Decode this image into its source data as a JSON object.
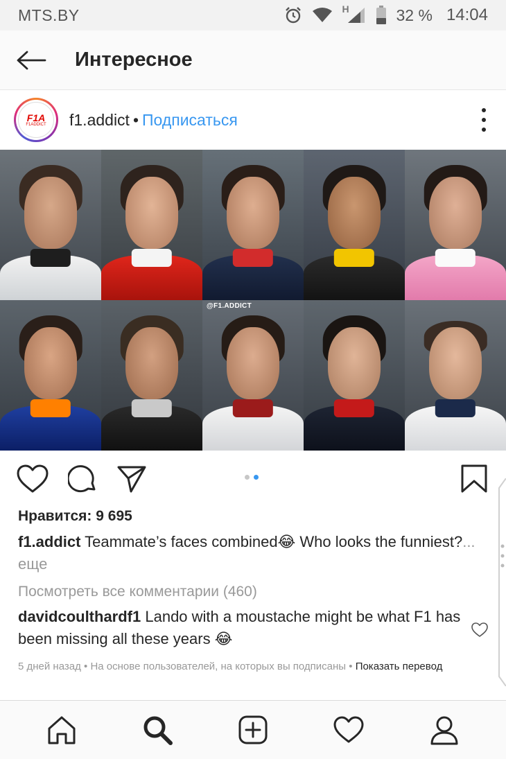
{
  "status_bar": {
    "carrier": "MTS.BY",
    "network_type": "H",
    "battery": "32 %",
    "time": "14:04",
    "icons": [
      "alarm-icon",
      "wifi-icon",
      "signal-icon",
      "battery-icon"
    ]
  },
  "header": {
    "title": "Интересное",
    "back_icon": "arrow-left-icon"
  },
  "post": {
    "username": "f1.addict",
    "separator": "•",
    "follow_label": "Подписаться",
    "avatar_logo": "F1A",
    "avatar_logo_sub": "F1ADDICT",
    "watermark": "@F1.ADDICT",
    "image_count": 2,
    "active_image": 2,
    "actions": [
      "heart-icon",
      "comment-icon",
      "share-icon",
      "bookmark-icon"
    ],
    "likes_text": "Нравится: 9 695",
    "caption": {
      "user": "f1.addict",
      "text": " Teammate’s faces combined😂 Who looks the funniest?",
      "more": "... еще"
    },
    "view_comments": "Посмотреть все комментарии (460)",
    "top_comment": {
      "user": "davidcoulthardf1",
      "text": " Lando with a moustache might be what F1 has been missing all these years 😂"
    },
    "meta": {
      "time_ago": "5 дней назад",
      "reason": " • На основе пользователей, на которых вы подписаны • ",
      "translate": "Показать перевод"
    }
  },
  "bottom_nav": [
    "home-icon",
    "search-icon",
    "add-post-icon",
    "activity-heart-icon",
    "profile-icon"
  ],
  "colors": {
    "accent": "#3897f0",
    "text": "#262626",
    "muted": "#999999"
  }
}
